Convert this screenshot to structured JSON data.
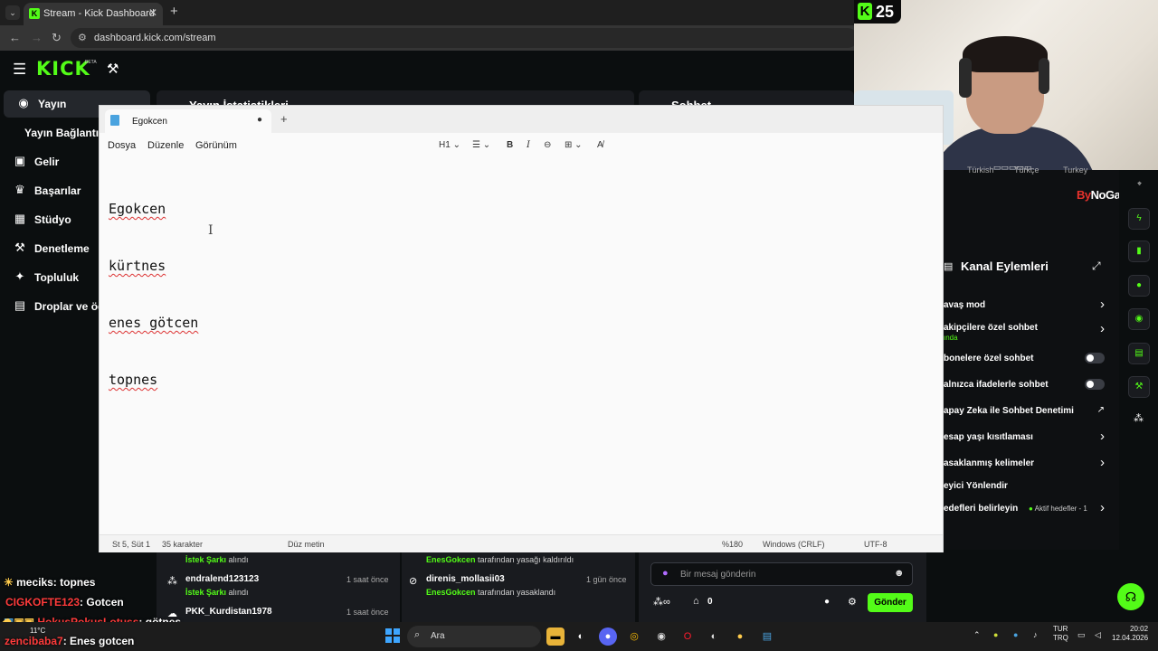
{
  "browser": {
    "tab_title": "Stream - Kick Dashboard",
    "url": "dashboard.kick.com/stream"
  },
  "kick": {
    "logo": "KICK",
    "beta": "BETA",
    "accent": "#53fc18",
    "sidebar": [
      {
        "label": "Yayın",
        "icon": "broadcast-icon"
      },
      {
        "label": "Yayın Bağlantısı",
        "icon": ""
      },
      {
        "label": "Gelir",
        "icon": "money-icon"
      },
      {
        "label": "Başarılar",
        "icon": "trophy-icon"
      },
      {
        "label": "Stüdyo",
        "icon": "studio-icon"
      },
      {
        "label": "Denetleme",
        "icon": "hammer-icon"
      },
      {
        "label": "Topluluk",
        "icon": "community-icon"
      },
      {
        "label": "Droplar ve ödü",
        "icon": "gift-icon"
      }
    ],
    "panel_stats_title": "Yayın İstatistikleri",
    "panel_chat_title": "Sohbet"
  },
  "notepad": {
    "tab_title": "Egokcen",
    "menu": [
      "Dosya",
      "Düzenle",
      "Görünüm"
    ],
    "heading_select": "H1",
    "lines": [
      "Egokcen",
      "kürtnes",
      "enes götcen",
      "topnes"
    ],
    "status": {
      "position": "St 5, Süt 1",
      "chars": "35 karakter",
      "format": "Düz metin",
      "zoom": "%180",
      "line_endings": "Windows (CRLF)",
      "encoding": "UTF-8"
    }
  },
  "webcam": {
    "badge_count": "25"
  },
  "right_panel": {
    "brand_by": "By",
    "brand_rest": "NoGame",
    "chips": [
      "Türkish",
      "Türkçe",
      "Turkey"
    ],
    "title": "Kanal Eylemleri",
    "rows": [
      {
        "label": "avaş mod",
        "control": "chevron"
      },
      {
        "label": "akipçilere özel sohbet",
        "sub": "ında",
        "control": "chevron"
      },
      {
        "label": "bonelere özel sohbet",
        "control": "toggle"
      },
      {
        "label": "alnızca ifadelerle sohbet",
        "control": "toggle"
      },
      {
        "label": "apay Zeka ile Sohbet Denetimi",
        "control": "external"
      },
      {
        "label": "esap yaşı kısıtlaması",
        "control": "chevron"
      },
      {
        "label": "asaklanmış kelimeler",
        "control": "chevron"
      },
      {
        "label": "eyici Yönlendir",
        "control": "none"
      },
      {
        "label": "edefleri belirleyin",
        "control": "goal",
        "goal_text": "Aktif hedefler - 1"
      }
    ]
  },
  "events_left": [
    {
      "name": "",
      "sub_hl": "İstek Şarkı",
      "sub": " alındı",
      "time": ""
    },
    {
      "name": "endralend123123",
      "sub_hl": "İstek Şarkı",
      "sub": " alındı",
      "time": "1 saat önce"
    },
    {
      "name": "PKK_Kurdistan1978",
      "sub_hl": "",
      "sub": "",
      "time": "1 saat önce"
    }
  ],
  "events_mid": [
    {
      "name": "",
      "sub_hl": "EnesGokcen",
      "sub": " tarafından yasağı kaldırıldı",
      "time": ""
    },
    {
      "name": "direnis_mollasii03",
      "sub_hl": "EnesGokcen",
      "sub": " tarafından yasaklandı",
      "time": "1 gün önce"
    }
  ],
  "chat": {
    "placeholder": "Bir mesaj gönderin",
    "points": "0",
    "send": "Gönder"
  },
  "overlay_chat": [
    {
      "user": "meciks",
      "color": "#ffffff",
      "msg": ": topnes"
    },
    {
      "user": "CIGKOFTE123",
      "color": "#ff3b3b",
      "msg": ": Gotcen"
    },
    {
      "user": "HokusPokusLotuss",
      "color": "#ff3b3b",
      "msg": ": götnes"
    },
    {
      "user": "zencibaba7",
      "color": "#ff3b3b",
      "msg": ": Enes gotcen"
    }
  ],
  "taskbar": {
    "search": "Ara",
    "weather": "11°C",
    "lang1": "TUR",
    "lang2": "TRQ",
    "time": "20:02",
    "date": "12.04.2026"
  }
}
